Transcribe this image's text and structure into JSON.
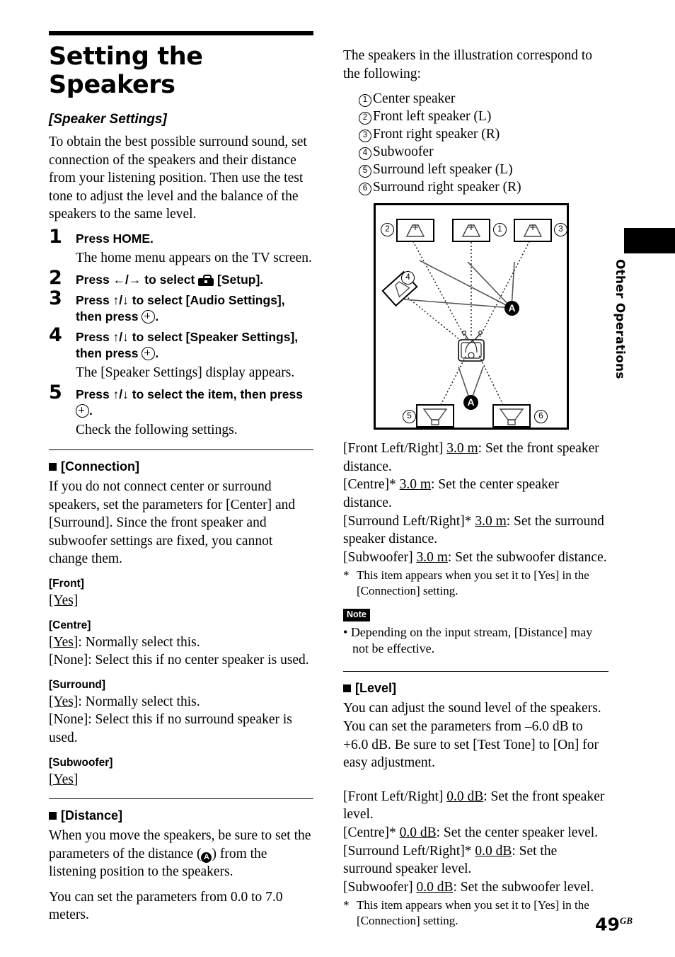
{
  "page": {
    "title": "Setting the Speakers",
    "number": "49",
    "number_suffix": "GB",
    "side_tab_label": "Other Operations"
  },
  "left": {
    "subtitle": "[Speaker Settings]",
    "intro": "To obtain the best possible surround sound, set connection of the speakers and their distance from your listening position. Then use the test tone to adjust the level and the balance of the speakers to the same level.",
    "steps": [
      {
        "num": "1",
        "head_before": "Press HOME.",
        "head_mid": "",
        "head_after": "",
        "sub": "The home menu appears on the TV screen."
      },
      {
        "num": "2",
        "head_before": "Press ←/→ to select",
        "head_mid": "",
        "head_after": "[Setup].",
        "sub": ""
      },
      {
        "num": "3",
        "head_before": "Press ↑/↓ to select [Audio Settings], then press",
        "head_mid": "",
        "head_after": ".",
        "sub": ""
      },
      {
        "num": "4",
        "head_before": "Press ↑/↓ to select [Speaker Settings], then press",
        "head_mid": "",
        "head_after": ".",
        "sub": "The [Speaker Settings] display appears."
      },
      {
        "num": "5",
        "head_before": "Press ↑/↓ to select the item, then press",
        "head_mid": "",
        "head_after": ".",
        "sub": "Check the following settings."
      }
    ],
    "connection": {
      "heading": "[Connection]",
      "body": "If you do not connect center or surround speakers, set the parameters for [Center] and [Surround]. Since the front speaker and subwoofer settings are fixed, you cannot change them.",
      "items": [
        {
          "label": "[Front]",
          "lines": [
            {
              "value": "[Yes]",
              "underline": true,
              "rest": ""
            }
          ]
        },
        {
          "label": "[Centre]",
          "lines": [
            {
              "value": "[Yes]",
              "underline": true,
              "rest": ": Normally select this."
            },
            {
              "value": "[None]",
              "underline": false,
              "rest": ": Select this if no center speaker is used."
            }
          ]
        },
        {
          "label": "[Surround]",
          "lines": [
            {
              "value": "[Yes]",
              "underline": true,
              "rest": ": Normally select this."
            },
            {
              "value": "[None]",
              "underline": false,
              "rest": ": Select this if no surround speaker is used."
            }
          ]
        },
        {
          "label": "[Subwoofer]",
          "lines": [
            {
              "value": "[Yes]",
              "underline": true,
              "rest": ""
            }
          ]
        }
      ]
    },
    "distance": {
      "heading": "[Distance]",
      "body_a": "When you move the speakers, be sure to set the parameters of the distance (",
      "body_b": ") from the listening position to the speakers.",
      "body_c": "You can set the parameters from 0.0 to 7.0 meters."
    }
  },
  "right": {
    "intro": "The speakers in the illustration correspond to the following:",
    "speaker_list": [
      {
        "num": "①",
        "label": "Center speaker"
      },
      {
        "num": "②",
        "label": "Front left speaker (L)"
      },
      {
        "num": "③",
        "label": "Front right speaker (R)"
      },
      {
        "num": "④",
        "label": "Subwoofer"
      },
      {
        "num": "⑤",
        "label": "Surround left speaker (L)"
      },
      {
        "num": "⑥",
        "label": "Surround right speaker (R)"
      }
    ],
    "diagram": {
      "markers": [
        "1",
        "2",
        "3",
        "4",
        "5",
        "6"
      ],
      "distance_label": "A"
    },
    "distance_settings": [
      {
        "label": "[Front Left/Right]",
        "star": "",
        "value": "3.0 m",
        "rest": ": Set the front speaker distance."
      },
      {
        "label": "[Centre]",
        "star": "*",
        "value": "3.0 m",
        "rest": ": Set the center speaker distance."
      },
      {
        "label": "[Surround Left/Right]",
        "star": "*",
        "value": "3.0 m",
        "rest": ": Set the surround speaker distance."
      },
      {
        "label": "[Subwoofer]",
        "star": "",
        "value": "3.0 m",
        "rest": ": Set the subwoofer distance."
      }
    ],
    "distance_footnote": "This item appears when you set it to [Yes] in the [Connection] setting.",
    "note": {
      "badge": "Note",
      "text": "Depending on the input stream, [Distance] may not be effective."
    },
    "level": {
      "heading": "[Level]",
      "body": "You can adjust the sound level of the speakers. You can set the parameters from –6.0 dB to +6.0 dB. Be sure to set [Test Tone] to [On] for easy adjustment."
    },
    "level_settings": [
      {
        "label": "[Front Left/Right]",
        "star": "",
        "value": "0.0 dB",
        "rest": ": Set the front speaker level."
      },
      {
        "label": "[Centre]",
        "star": "*",
        "value": "0.0 dB",
        "rest": ": Set the center speaker level."
      },
      {
        "label": "[Surround Left/Right]",
        "star": "*",
        "value": "0.0 dB",
        "rest": ": Set the surround speaker level."
      },
      {
        "label": "[Subwoofer]",
        "star": "",
        "value": "0.0 dB",
        "rest": ": Set the subwoofer level."
      }
    ],
    "level_footnote": "This item appears when you set it to [Yes] in the [Connection] setting.",
    "footnote_marker": "*"
  }
}
